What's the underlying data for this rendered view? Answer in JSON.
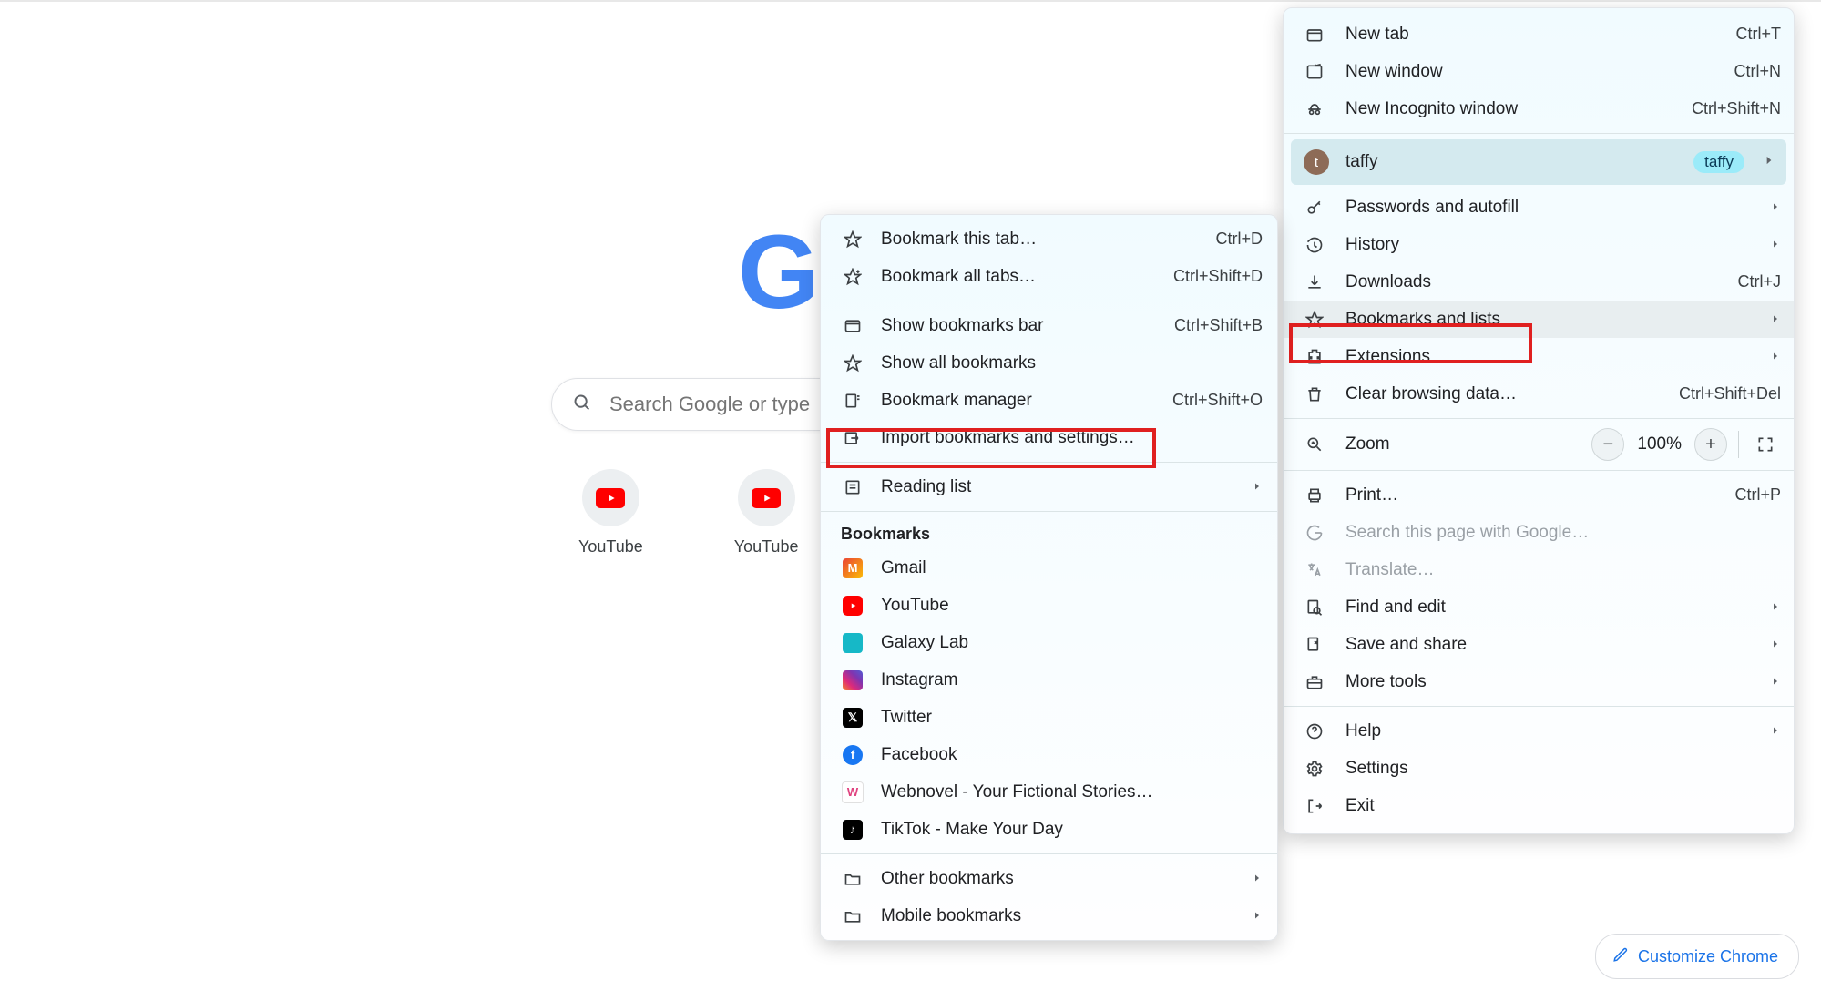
{
  "search": {
    "placeholder": "Search Google or type"
  },
  "shortcuts": [
    {
      "label": "YouTube"
    },
    {
      "label": "YouTube"
    }
  ],
  "customize": {
    "label": "Customize Chrome"
  },
  "main_menu": {
    "new_tab": {
      "label": "New tab",
      "shortcut": "Ctrl+T"
    },
    "new_window": {
      "label": "New window",
      "shortcut": "Ctrl+N"
    },
    "new_incognito": {
      "label": "New Incognito window",
      "shortcut": "Ctrl+Shift+N"
    },
    "profile": {
      "name": "taffy",
      "pill": "taffy",
      "avatar_letter": "t"
    },
    "passwords": {
      "label": "Passwords and autofill"
    },
    "history": {
      "label": "History"
    },
    "downloads": {
      "label": "Downloads",
      "shortcut": "Ctrl+J"
    },
    "bookmarks": {
      "label": "Bookmarks and lists"
    },
    "extensions": {
      "label": "Extensions"
    },
    "clear_data": {
      "label": "Clear browsing data…",
      "shortcut": "Ctrl+Shift+Del"
    },
    "zoom": {
      "label": "Zoom",
      "level": "100%"
    },
    "print": {
      "label": "Print…",
      "shortcut": "Ctrl+P"
    },
    "search_page": {
      "label": "Search this page with Google…"
    },
    "translate": {
      "label": "Translate…"
    },
    "find_edit": {
      "label": "Find and edit"
    },
    "save_share": {
      "label": "Save and share"
    },
    "more_tools": {
      "label": "More tools"
    },
    "help": {
      "label": "Help"
    },
    "settings": {
      "label": "Settings"
    },
    "exit": {
      "label": "Exit"
    }
  },
  "submenu": {
    "bookmark_tab": {
      "label": "Bookmark this tab…",
      "shortcut": "Ctrl+D"
    },
    "bookmark_all": {
      "label": "Bookmark all tabs…",
      "shortcut": "Ctrl+Shift+D"
    },
    "show_bar": {
      "label": "Show bookmarks bar",
      "shortcut": "Ctrl+Shift+B"
    },
    "show_all": {
      "label": "Show all bookmarks"
    },
    "manager": {
      "label": "Bookmark manager",
      "shortcut": "Ctrl+Shift+O"
    },
    "import": {
      "label": "Import bookmarks and settings…"
    },
    "reading_list": {
      "label": "Reading list"
    },
    "section_title": "Bookmarks",
    "items": [
      {
        "label": "Gmail"
      },
      {
        "label": "YouTube"
      },
      {
        "label": "Galaxy Lab"
      },
      {
        "label": "Instagram"
      },
      {
        "label": "Twitter"
      },
      {
        "label": "Facebook"
      },
      {
        "label": "Webnovel - Your Fictional Stories…"
      },
      {
        "label": "TikTok - Make Your Day"
      }
    ],
    "other": {
      "label": "Other bookmarks"
    },
    "mobile": {
      "label": "Mobile bookmarks"
    }
  }
}
